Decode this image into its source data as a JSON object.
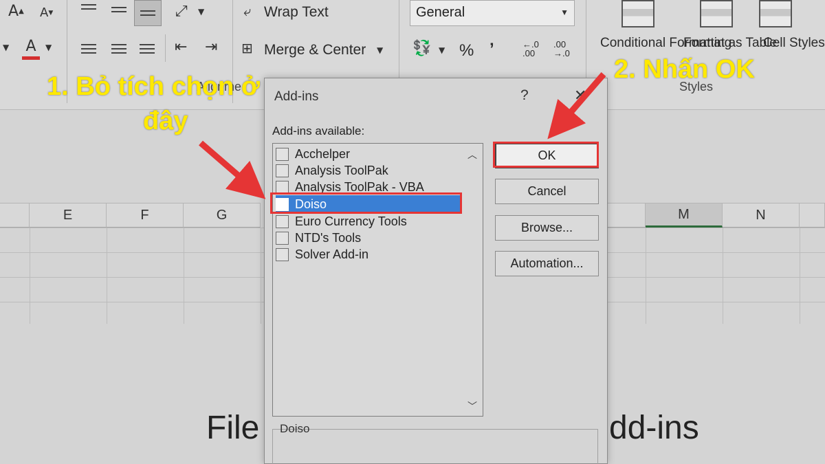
{
  "ribbon": {
    "wrap_text": "Wrap Text",
    "merge_center": "Merge & Center",
    "number_format": "General",
    "percent": "%",
    "comma": "’",
    "inc_decimal": "←.0\n.00",
    "dec_decimal": ".00\n→.0",
    "conditional_formatting": "Conditional Formatting",
    "format_as_table": "Format as Table",
    "cell_styles": "Cell Styles",
    "styles_group": "Styles",
    "font_a_large": "A",
    "font_a_small": "A",
    "font_color_a": "A",
    "alignment_partial": "Alignme"
  },
  "sheet": {
    "columns": [
      "E",
      "F",
      "G",
      "M",
      "N"
    ],
    "selected_column": "M",
    "caption_left": "File",
    "caption_right": "dd-ins"
  },
  "dialog": {
    "title": "Add-ins",
    "help": "?",
    "close": "✕",
    "available_label": "Add-ins available:",
    "items": [
      {
        "label": "Acchelper",
        "checked": false
      },
      {
        "label": "Analysis ToolPak",
        "checked": false
      },
      {
        "label": "Analysis ToolPak - VBA",
        "checked": false
      },
      {
        "label": "Doiso",
        "checked": false,
        "selected": true
      },
      {
        "label": "Euro Currency Tools",
        "checked": false
      },
      {
        "label": "NTD's Tools",
        "checked": false
      },
      {
        "label": "Solver Add-in",
        "checked": false
      }
    ],
    "description_label": "Doiso",
    "buttons": {
      "ok": "OK",
      "cancel": "Cancel",
      "browse": "Browse...",
      "automation": "Automation..."
    }
  },
  "annotations": {
    "step1_line1": "1. Bỏ tích chọn ở",
    "step1_line2": "đây",
    "step2": "2. Nhấn OK",
    "highlight_color": "#e53535",
    "text_color": "#ffe900"
  }
}
